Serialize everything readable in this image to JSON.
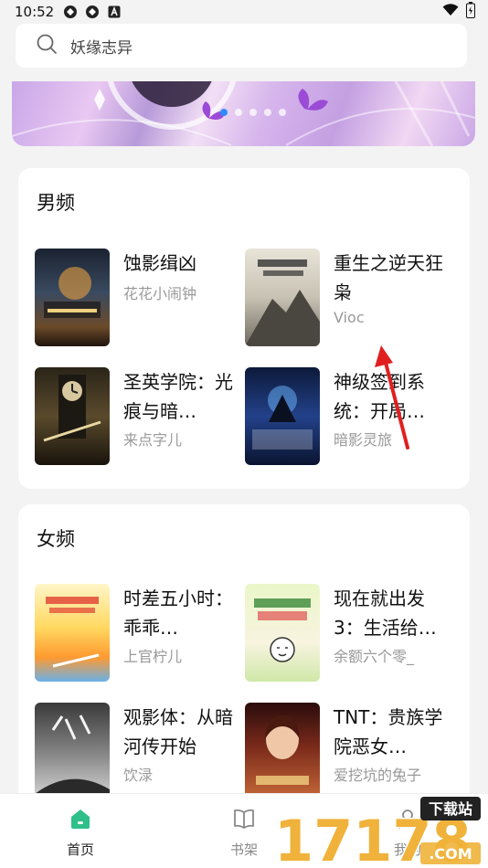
{
  "status_bar": {
    "time": "10:52"
  },
  "search": {
    "placeholder": "妖缘志异"
  },
  "banner": {
    "pages": 5,
    "active_page": 1
  },
  "male_section": {
    "title": "男频",
    "books": [
      {
        "title": "蚀影缉凶",
        "author": "花花小闹钟"
      },
      {
        "title": "重生之逆天狂枭",
        "author": "Vioc"
      },
      {
        "title": "圣英学院：光痕与暗…",
        "author": "来点字儿"
      },
      {
        "title": "神级签到系统：开局…",
        "author": "暗影灵旅"
      }
    ]
  },
  "female_section": {
    "title": "女频",
    "books": [
      {
        "title": "时差五小时：乖乖…",
        "author": "上官柠儿"
      },
      {
        "title": "现在就出发3：生活给…",
        "author": "余额六个零_"
      },
      {
        "title": "观影体：从暗河传开始",
        "author": "饮渌"
      },
      {
        "title": "TNT：贵族学院恶女…",
        "author": "爱挖坑的兔子"
      }
    ]
  },
  "bottom_nav": {
    "items": [
      {
        "label": "首页",
        "icon": "home-icon",
        "active": true
      },
      {
        "label": "书架",
        "icon": "book-icon",
        "active": false
      },
      {
        "label": "我的",
        "icon": "user-icon",
        "active": false
      }
    ]
  },
  "colors": {
    "accent": "#2fbf8a",
    "inactive": "#888888",
    "annotation_arrow": "#e02020"
  }
}
